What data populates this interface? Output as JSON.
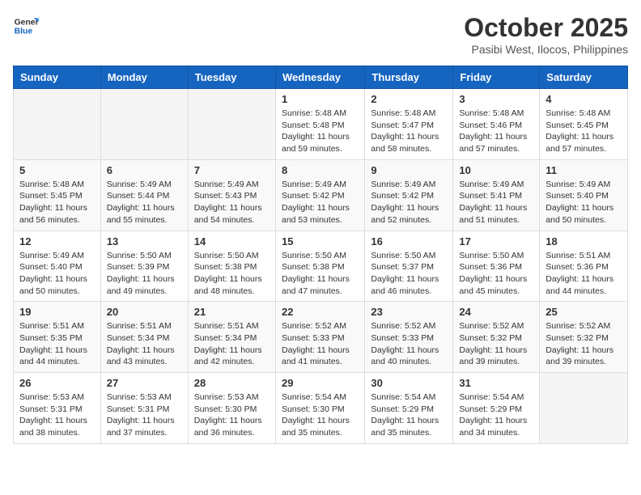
{
  "header": {
    "logo_line1": "General",
    "logo_line2": "Blue",
    "month": "October 2025",
    "location": "Pasibi West, Ilocos, Philippines"
  },
  "weekdays": [
    "Sunday",
    "Monday",
    "Tuesday",
    "Wednesday",
    "Thursday",
    "Friday",
    "Saturday"
  ],
  "weeks": [
    [
      {
        "day": "",
        "sunrise": "",
        "sunset": "",
        "daylight": ""
      },
      {
        "day": "",
        "sunrise": "",
        "sunset": "",
        "daylight": ""
      },
      {
        "day": "",
        "sunrise": "",
        "sunset": "",
        "daylight": ""
      },
      {
        "day": "1",
        "sunrise": "Sunrise: 5:48 AM",
        "sunset": "Sunset: 5:48 PM",
        "daylight": "Daylight: 11 hours and 59 minutes."
      },
      {
        "day": "2",
        "sunrise": "Sunrise: 5:48 AM",
        "sunset": "Sunset: 5:47 PM",
        "daylight": "Daylight: 11 hours and 58 minutes."
      },
      {
        "day": "3",
        "sunrise": "Sunrise: 5:48 AM",
        "sunset": "Sunset: 5:46 PM",
        "daylight": "Daylight: 11 hours and 57 minutes."
      },
      {
        "day": "4",
        "sunrise": "Sunrise: 5:48 AM",
        "sunset": "Sunset: 5:45 PM",
        "daylight": "Daylight: 11 hours and 57 minutes."
      }
    ],
    [
      {
        "day": "5",
        "sunrise": "Sunrise: 5:48 AM",
        "sunset": "Sunset: 5:45 PM",
        "daylight": "Daylight: 11 hours and 56 minutes."
      },
      {
        "day": "6",
        "sunrise": "Sunrise: 5:49 AM",
        "sunset": "Sunset: 5:44 PM",
        "daylight": "Daylight: 11 hours and 55 minutes."
      },
      {
        "day": "7",
        "sunrise": "Sunrise: 5:49 AM",
        "sunset": "Sunset: 5:43 PM",
        "daylight": "Daylight: 11 hours and 54 minutes."
      },
      {
        "day": "8",
        "sunrise": "Sunrise: 5:49 AM",
        "sunset": "Sunset: 5:42 PM",
        "daylight": "Daylight: 11 hours and 53 minutes."
      },
      {
        "day": "9",
        "sunrise": "Sunrise: 5:49 AM",
        "sunset": "Sunset: 5:42 PM",
        "daylight": "Daylight: 11 hours and 52 minutes."
      },
      {
        "day": "10",
        "sunrise": "Sunrise: 5:49 AM",
        "sunset": "Sunset: 5:41 PM",
        "daylight": "Daylight: 11 hours and 51 minutes."
      },
      {
        "day": "11",
        "sunrise": "Sunrise: 5:49 AM",
        "sunset": "Sunset: 5:40 PM",
        "daylight": "Daylight: 11 hours and 50 minutes."
      }
    ],
    [
      {
        "day": "12",
        "sunrise": "Sunrise: 5:49 AM",
        "sunset": "Sunset: 5:40 PM",
        "daylight": "Daylight: 11 hours and 50 minutes."
      },
      {
        "day": "13",
        "sunrise": "Sunrise: 5:50 AM",
        "sunset": "Sunset: 5:39 PM",
        "daylight": "Daylight: 11 hours and 49 minutes."
      },
      {
        "day": "14",
        "sunrise": "Sunrise: 5:50 AM",
        "sunset": "Sunset: 5:38 PM",
        "daylight": "Daylight: 11 hours and 48 minutes."
      },
      {
        "day": "15",
        "sunrise": "Sunrise: 5:50 AM",
        "sunset": "Sunset: 5:38 PM",
        "daylight": "Daylight: 11 hours and 47 minutes."
      },
      {
        "day": "16",
        "sunrise": "Sunrise: 5:50 AM",
        "sunset": "Sunset: 5:37 PM",
        "daylight": "Daylight: 11 hours and 46 minutes."
      },
      {
        "day": "17",
        "sunrise": "Sunrise: 5:50 AM",
        "sunset": "Sunset: 5:36 PM",
        "daylight": "Daylight: 11 hours and 45 minutes."
      },
      {
        "day": "18",
        "sunrise": "Sunrise: 5:51 AM",
        "sunset": "Sunset: 5:36 PM",
        "daylight": "Daylight: 11 hours and 44 minutes."
      }
    ],
    [
      {
        "day": "19",
        "sunrise": "Sunrise: 5:51 AM",
        "sunset": "Sunset: 5:35 PM",
        "daylight": "Daylight: 11 hours and 44 minutes."
      },
      {
        "day": "20",
        "sunrise": "Sunrise: 5:51 AM",
        "sunset": "Sunset: 5:34 PM",
        "daylight": "Daylight: 11 hours and 43 minutes."
      },
      {
        "day": "21",
        "sunrise": "Sunrise: 5:51 AM",
        "sunset": "Sunset: 5:34 PM",
        "daylight": "Daylight: 11 hours and 42 minutes."
      },
      {
        "day": "22",
        "sunrise": "Sunrise: 5:52 AM",
        "sunset": "Sunset: 5:33 PM",
        "daylight": "Daylight: 11 hours and 41 minutes."
      },
      {
        "day": "23",
        "sunrise": "Sunrise: 5:52 AM",
        "sunset": "Sunset: 5:33 PM",
        "daylight": "Daylight: 11 hours and 40 minutes."
      },
      {
        "day": "24",
        "sunrise": "Sunrise: 5:52 AM",
        "sunset": "Sunset: 5:32 PM",
        "daylight": "Daylight: 11 hours and 39 minutes."
      },
      {
        "day": "25",
        "sunrise": "Sunrise: 5:52 AM",
        "sunset": "Sunset: 5:32 PM",
        "daylight": "Daylight: 11 hours and 39 minutes."
      }
    ],
    [
      {
        "day": "26",
        "sunrise": "Sunrise: 5:53 AM",
        "sunset": "Sunset: 5:31 PM",
        "daylight": "Daylight: 11 hours and 38 minutes."
      },
      {
        "day": "27",
        "sunrise": "Sunrise: 5:53 AM",
        "sunset": "Sunset: 5:31 PM",
        "daylight": "Daylight: 11 hours and 37 minutes."
      },
      {
        "day": "28",
        "sunrise": "Sunrise: 5:53 AM",
        "sunset": "Sunset: 5:30 PM",
        "daylight": "Daylight: 11 hours and 36 minutes."
      },
      {
        "day": "29",
        "sunrise": "Sunrise: 5:54 AM",
        "sunset": "Sunset: 5:30 PM",
        "daylight": "Daylight: 11 hours and 35 minutes."
      },
      {
        "day": "30",
        "sunrise": "Sunrise: 5:54 AM",
        "sunset": "Sunset: 5:29 PM",
        "daylight": "Daylight: 11 hours and 35 minutes."
      },
      {
        "day": "31",
        "sunrise": "Sunrise: 5:54 AM",
        "sunset": "Sunset: 5:29 PM",
        "daylight": "Daylight: 11 hours and 34 minutes."
      },
      {
        "day": "",
        "sunrise": "",
        "sunset": "",
        "daylight": ""
      }
    ]
  ]
}
